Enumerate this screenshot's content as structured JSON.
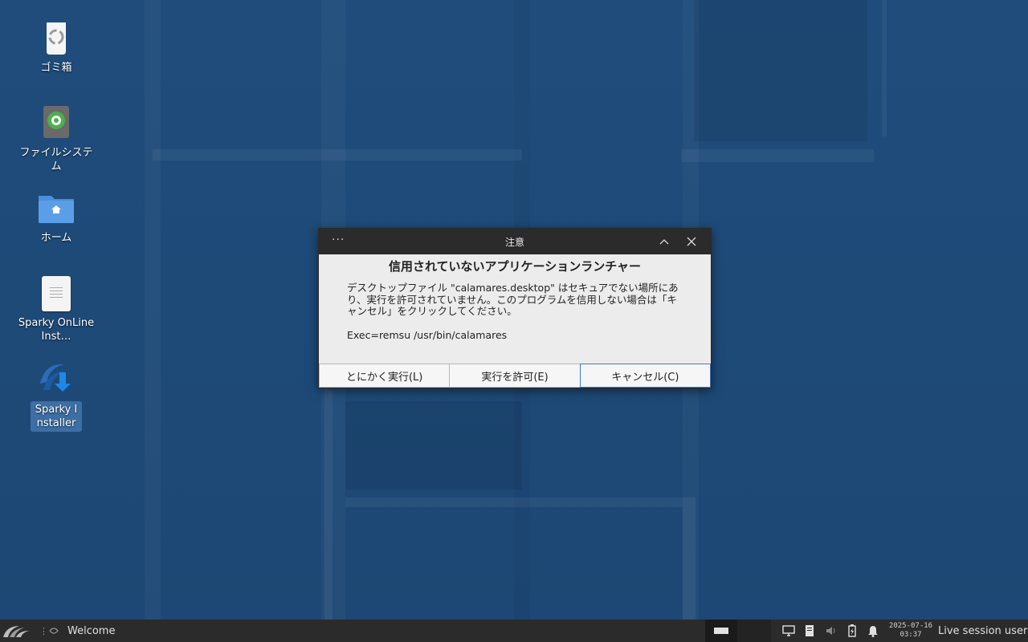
{
  "desktop": {
    "icons": [
      {
        "label": "ゴミ箱",
        "icon": "trash-icon"
      },
      {
        "label": "ファイルシステム",
        "icon": "filesystem-icon"
      },
      {
        "label": "ホーム",
        "icon": "home-folder-icon"
      },
      {
        "label": "Sparky OnLine Inst…",
        "icon": "document-icon"
      },
      {
        "label": "Sparky Installer",
        "icon": "installer-icon"
      }
    ]
  },
  "dialog": {
    "window_title": "注意",
    "heading": "信用されていないアプリケーションランチャー",
    "message": "デスクトップファイル \"calamares.desktop\" はセキュアでない場所にあり、実行を許可されていません。このプログラムを信用しない場合は「キャンセル」をクリックしてください。",
    "exec_line": "Exec=remsu /usr/bin/calamares",
    "buttons": {
      "run_anyway": "とにかく実行(L)",
      "allow": "実行を許可(E)",
      "cancel": "キャンセル(C)"
    }
  },
  "taskbar": {
    "task_label": "Welcome",
    "clock": {
      "date": "2025-07-16",
      "time": "03:37"
    },
    "user": "Live session user"
  },
  "colors": {
    "desktop_bg": "#1e4a78",
    "taskbar_bg": "#2b2b2b",
    "titlebar_bg": "#2b2b2b",
    "focus_border": "#3f79c8",
    "selection": "#3d6fa5"
  }
}
